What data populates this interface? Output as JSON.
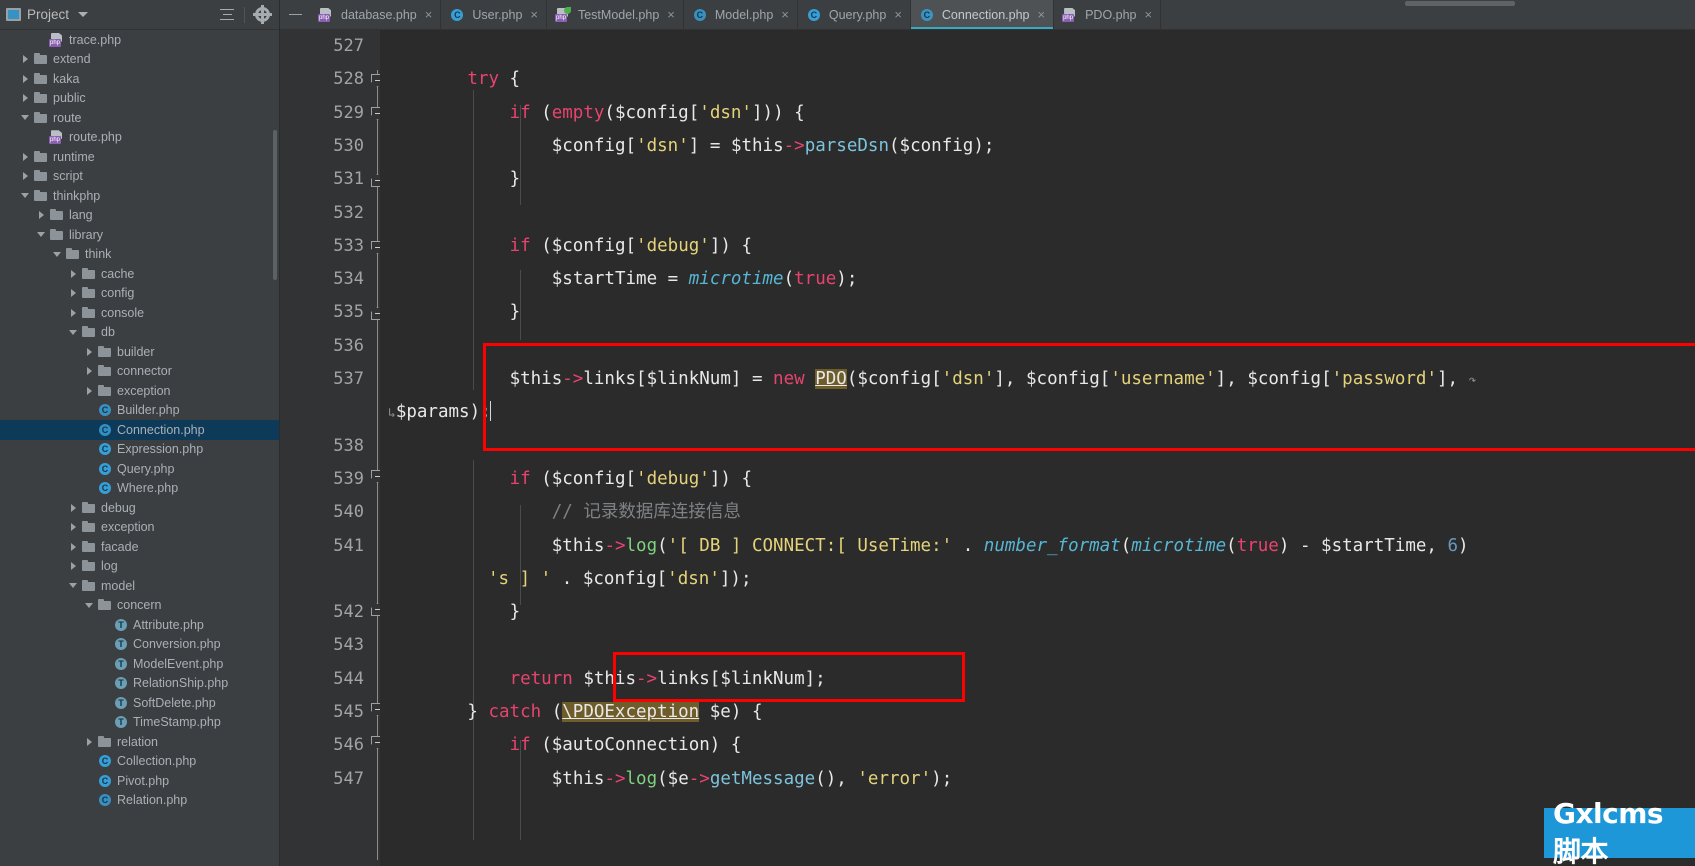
{
  "project_panel": {
    "title": "Project",
    "icons": {
      "collapse_all": "collapse-all-icon",
      "settings": "gear-icon",
      "dropdown": "chevron-down-icon"
    },
    "tree": [
      {
        "label": "trace.php",
        "indent": 2,
        "icon": "php",
        "twisty": "none"
      },
      {
        "label": "extend",
        "indent": 1,
        "icon": "folder",
        "twisty": "collapsed"
      },
      {
        "label": "kaka",
        "indent": 1,
        "icon": "folder",
        "twisty": "collapsed"
      },
      {
        "label": "public",
        "indent": 1,
        "icon": "folder",
        "twisty": "collapsed"
      },
      {
        "label": "route",
        "indent": 1,
        "icon": "folder",
        "twisty": "expanded"
      },
      {
        "label": "route.php",
        "indent": 2,
        "icon": "php",
        "twisty": "none"
      },
      {
        "label": "runtime",
        "indent": 1,
        "icon": "folder",
        "twisty": "collapsed"
      },
      {
        "label": "script",
        "indent": 1,
        "icon": "folder",
        "twisty": "collapsed"
      },
      {
        "label": "thinkphp",
        "indent": 1,
        "icon": "folder",
        "twisty": "expanded"
      },
      {
        "label": "lang",
        "indent": 2,
        "icon": "folder",
        "twisty": "collapsed"
      },
      {
        "label": "library",
        "indent": 2,
        "icon": "folder",
        "twisty": "expanded"
      },
      {
        "label": "think",
        "indent": 3,
        "icon": "folder",
        "twisty": "expanded"
      },
      {
        "label": "cache",
        "indent": 4,
        "icon": "folder",
        "twisty": "collapsed"
      },
      {
        "label": "config",
        "indent": 4,
        "icon": "folder",
        "twisty": "collapsed"
      },
      {
        "label": "console",
        "indent": 4,
        "icon": "folder",
        "twisty": "collapsed"
      },
      {
        "label": "db",
        "indent": 4,
        "icon": "folder",
        "twisty": "expanded"
      },
      {
        "label": "builder",
        "indent": 5,
        "icon": "folder",
        "twisty": "collapsed"
      },
      {
        "label": "connector",
        "indent": 5,
        "icon": "folder",
        "twisty": "collapsed"
      },
      {
        "label": "exception",
        "indent": 5,
        "icon": "folder",
        "twisty": "collapsed"
      },
      {
        "label": "Builder.php",
        "indent": 5,
        "icon": "class-abstract",
        "twisty": "none"
      },
      {
        "label": "Connection.php",
        "indent": 5,
        "icon": "class-abstract",
        "twisty": "none",
        "selected": true
      },
      {
        "label": "Expression.php",
        "indent": 5,
        "icon": "class",
        "twisty": "none"
      },
      {
        "label": "Query.php",
        "indent": 5,
        "icon": "class",
        "twisty": "none"
      },
      {
        "label": "Where.php",
        "indent": 5,
        "icon": "class",
        "twisty": "none"
      },
      {
        "label": "debug",
        "indent": 4,
        "icon": "folder",
        "twisty": "collapsed"
      },
      {
        "label": "exception",
        "indent": 4,
        "icon": "folder",
        "twisty": "collapsed"
      },
      {
        "label": "facade",
        "indent": 4,
        "icon": "folder",
        "twisty": "collapsed"
      },
      {
        "label": "log",
        "indent": 4,
        "icon": "folder",
        "twisty": "collapsed"
      },
      {
        "label": "model",
        "indent": 4,
        "icon": "folder",
        "twisty": "expanded"
      },
      {
        "label": "concern",
        "indent": 5,
        "icon": "folder",
        "twisty": "expanded"
      },
      {
        "label": "Attribute.php",
        "indent": 6,
        "icon": "trait",
        "twisty": "none"
      },
      {
        "label": "Conversion.php",
        "indent": 6,
        "icon": "trait",
        "twisty": "none"
      },
      {
        "label": "ModelEvent.php",
        "indent": 6,
        "icon": "trait",
        "twisty": "none"
      },
      {
        "label": "RelationShip.php",
        "indent": 6,
        "icon": "trait",
        "twisty": "none"
      },
      {
        "label": "SoftDelete.php",
        "indent": 6,
        "icon": "trait",
        "twisty": "none"
      },
      {
        "label": "TimeStamp.php",
        "indent": 6,
        "icon": "trait",
        "twisty": "none"
      },
      {
        "label": "relation",
        "indent": 5,
        "icon": "folder",
        "twisty": "collapsed"
      },
      {
        "label": "Collection.php",
        "indent": 5,
        "icon": "class",
        "twisty": "none"
      },
      {
        "label": "Pivot.php",
        "indent": 5,
        "icon": "class",
        "twisty": "none"
      },
      {
        "label": "Relation.php",
        "indent": 5,
        "icon": "class-abstract",
        "twisty": "none"
      }
    ]
  },
  "tabs": [
    {
      "label": "database.php",
      "icon": "php-file-icon",
      "active": false
    },
    {
      "label": "User.php",
      "icon": "php-class-icon",
      "active": false
    },
    {
      "label": "TestModel.php",
      "icon": "php-file-green-icon",
      "active": false
    },
    {
      "label": "Model.php",
      "icon": "php-abstract-class-icon",
      "active": false
    },
    {
      "label": "Query.php",
      "icon": "php-class-icon",
      "active": false
    },
    {
      "label": "Connection.php",
      "icon": "php-abstract-class-icon",
      "active": true
    },
    {
      "label": "PDO.php",
      "icon": "php-file-icon",
      "active": false
    }
  ],
  "editor": {
    "first_line": 527,
    "line_numbers": [
      527,
      528,
      529,
      530,
      531,
      532,
      533,
      534,
      535,
      536,
      537,
      538,
      539,
      540,
      541,
      542,
      543,
      544,
      545,
      546,
      547
    ],
    "lines": [
      {
        "n": 527,
        "text": ""
      },
      {
        "n": 528,
        "text": "        try {"
      },
      {
        "n": 529,
        "text": "            if (empty($config['dsn'])) {"
      },
      {
        "n": 530,
        "text": "                $config['dsn'] = $this->parseDsn($config);"
      },
      {
        "n": 531,
        "text": "            }"
      },
      {
        "n": 532,
        "text": ""
      },
      {
        "n": 533,
        "text": "            if ($config['debug']) {"
      },
      {
        "n": 534,
        "text": "                $startTime = microtime(true);"
      },
      {
        "n": 535,
        "text": "            }"
      },
      {
        "n": 536,
        "text": ""
      },
      {
        "n": 537,
        "text": "            $this->links[$linkNum] = new PDO($config['dsn'], $config['username'], $config['password'], $params);"
      },
      {
        "n": 538,
        "text": ""
      },
      {
        "n": 539,
        "text": "            if ($config['debug']) {"
      },
      {
        "n": 540,
        "text": "                // 记录数据库连接信息"
      },
      {
        "n": 541,
        "text": "                $this->log('[ DB ] CONNECT:[ UseTime:' . number_format(microtime(true) - $startTime, 6) . 's ] ' . $config['dsn']);"
      },
      {
        "n": 542,
        "text": "            }"
      },
      {
        "n": 543,
        "text": ""
      },
      {
        "n": 544,
        "text": "            return $this->links[$linkNum];"
      },
      {
        "n": 545,
        "text": "        } catch (\\PDOException $e) {"
      },
      {
        "n": 546,
        "text": "            if ($autoConnection) {"
      },
      {
        "n": 547,
        "text": "                $this->log($e->getMessage(), 'error');"
      }
    ],
    "highlighted_identifiers": [
      "PDO",
      "\\PDOException"
    ],
    "comment_text": "// 记录数据库连接信息",
    "annotation_color": "#ff0000",
    "annotations": [
      {
        "name": "pdo-instantiation-box",
        "target_line": 537
      },
      {
        "name": "return-links-box",
        "target_line": 544
      }
    ]
  },
  "watermark": {
    "text": "Gxlcms脚本",
    "background": "#1e97d8",
    "color": "#ffffff"
  }
}
